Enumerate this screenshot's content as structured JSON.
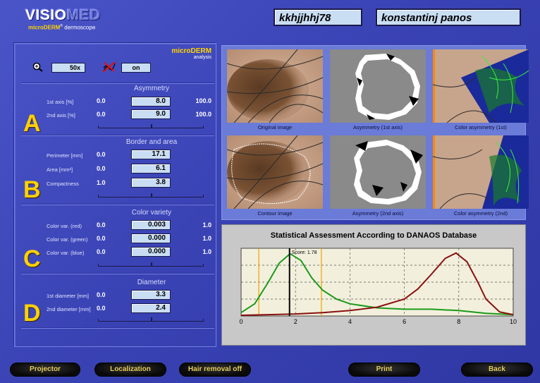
{
  "header": {
    "logo_main_a": "VISIO",
    "logo_main_b": "MED",
    "logo_sub_a": "microDERM",
    "logo_sub_reg": "®",
    "logo_sub_b": " dermoscope",
    "patient_id": "kkhjjhhj78",
    "patient_name": "konstantinj panos"
  },
  "panel": {
    "zoom_value": "50x",
    "hair_value": "on",
    "brand_main": "microDERM",
    "brand_sub": "analysis"
  },
  "sections": {
    "asymmetry": {
      "letter": "A",
      "title": "Asymmetry",
      "rows": [
        {
          "label": "1st axis [%]",
          "min": "0.0",
          "value": "8.0",
          "max": "100.0"
        },
        {
          "label": "2nd axis [%]",
          "min": "0.0",
          "value": "9.0",
          "max": "100.0"
        }
      ]
    },
    "border": {
      "letter": "B",
      "title": "Border and area",
      "rows": [
        {
          "label": "Perimeter [mm]",
          "min": "0.0",
          "value": "17.1"
        },
        {
          "label": "Area [mm²]",
          "min": "0.0",
          "value": "6.1"
        },
        {
          "label": "Compactness",
          "min": "1.0",
          "value": "3.8"
        }
      ]
    },
    "color": {
      "letter": "C",
      "title": "Color variety",
      "rows": [
        {
          "label": "Color var. (red)",
          "min": "0.0",
          "value": "0.003",
          "max": "1.0"
        },
        {
          "label": "Color var. (green)",
          "min": "0.0",
          "value": "0.000",
          "max": "1.0"
        },
        {
          "label": "Color var. (blue)",
          "min": "0.0",
          "value": "0.000",
          "max": "1.0"
        }
      ]
    },
    "diameter": {
      "letter": "D",
      "title": "Diameter",
      "rows": [
        {
          "label": "1st diameter [mm]",
          "min": "0.0",
          "value": "3.3"
        },
        {
          "label": "2nd diameter [mm]",
          "min": "0.0",
          "value": "2.4"
        }
      ]
    }
  },
  "images": [
    {
      "caption": "Original image"
    },
    {
      "caption": "Asymmetry (1st axis)"
    },
    {
      "caption": "Color asymmetry (1st)"
    },
    {
      "caption": "Contour image"
    },
    {
      "caption": "Asymmetry (2nd axis)"
    },
    {
      "caption": "Color asymmetry (2nd)"
    }
  ],
  "chart_data": {
    "type": "line",
    "title": "Statistical Assessment According to DANAOS Database",
    "xlim": [
      0,
      10
    ],
    "x_ticks": [
      "0",
      "2",
      "4",
      "6",
      "8",
      "10"
    ],
    "grid": true,
    "score_label": "Score: 1.78",
    "score": 1.78,
    "thresholds": [
      0.65,
      2.95
    ],
    "series": [
      {
        "color": "#1a9a1a",
        "x": [
          0,
          0.5,
          1.0,
          1.4,
          1.8,
          2.2,
          2.6,
          3.0,
          3.5,
          4.0,
          5.0,
          6.0,
          7.0,
          8.0,
          9.0,
          10.0
        ],
        "y": [
          0.05,
          0.18,
          0.5,
          0.78,
          0.92,
          0.82,
          0.56,
          0.38,
          0.25,
          0.18,
          0.12,
          0.1,
          0.1,
          0.08,
          0.04,
          0.02
        ]
      },
      {
        "color": "#8a1010",
        "x": [
          0,
          1.0,
          2.0,
          3.0,
          4.0,
          5.0,
          6.0,
          6.5,
          7.0,
          7.5,
          7.9,
          8.3,
          8.7,
          9.0,
          9.5,
          10.0
        ],
        "y": [
          0.01,
          0.02,
          0.03,
          0.05,
          0.08,
          0.13,
          0.25,
          0.4,
          0.62,
          0.85,
          0.93,
          0.8,
          0.5,
          0.25,
          0.06,
          0.02
        ]
      }
    ],
    "ylim": [
      0,
      1.0
    ]
  },
  "footer": {
    "projector": "Projector",
    "localization": "Localization",
    "hair_removal": "Hair removal off",
    "print": "Print",
    "back": "Back"
  }
}
